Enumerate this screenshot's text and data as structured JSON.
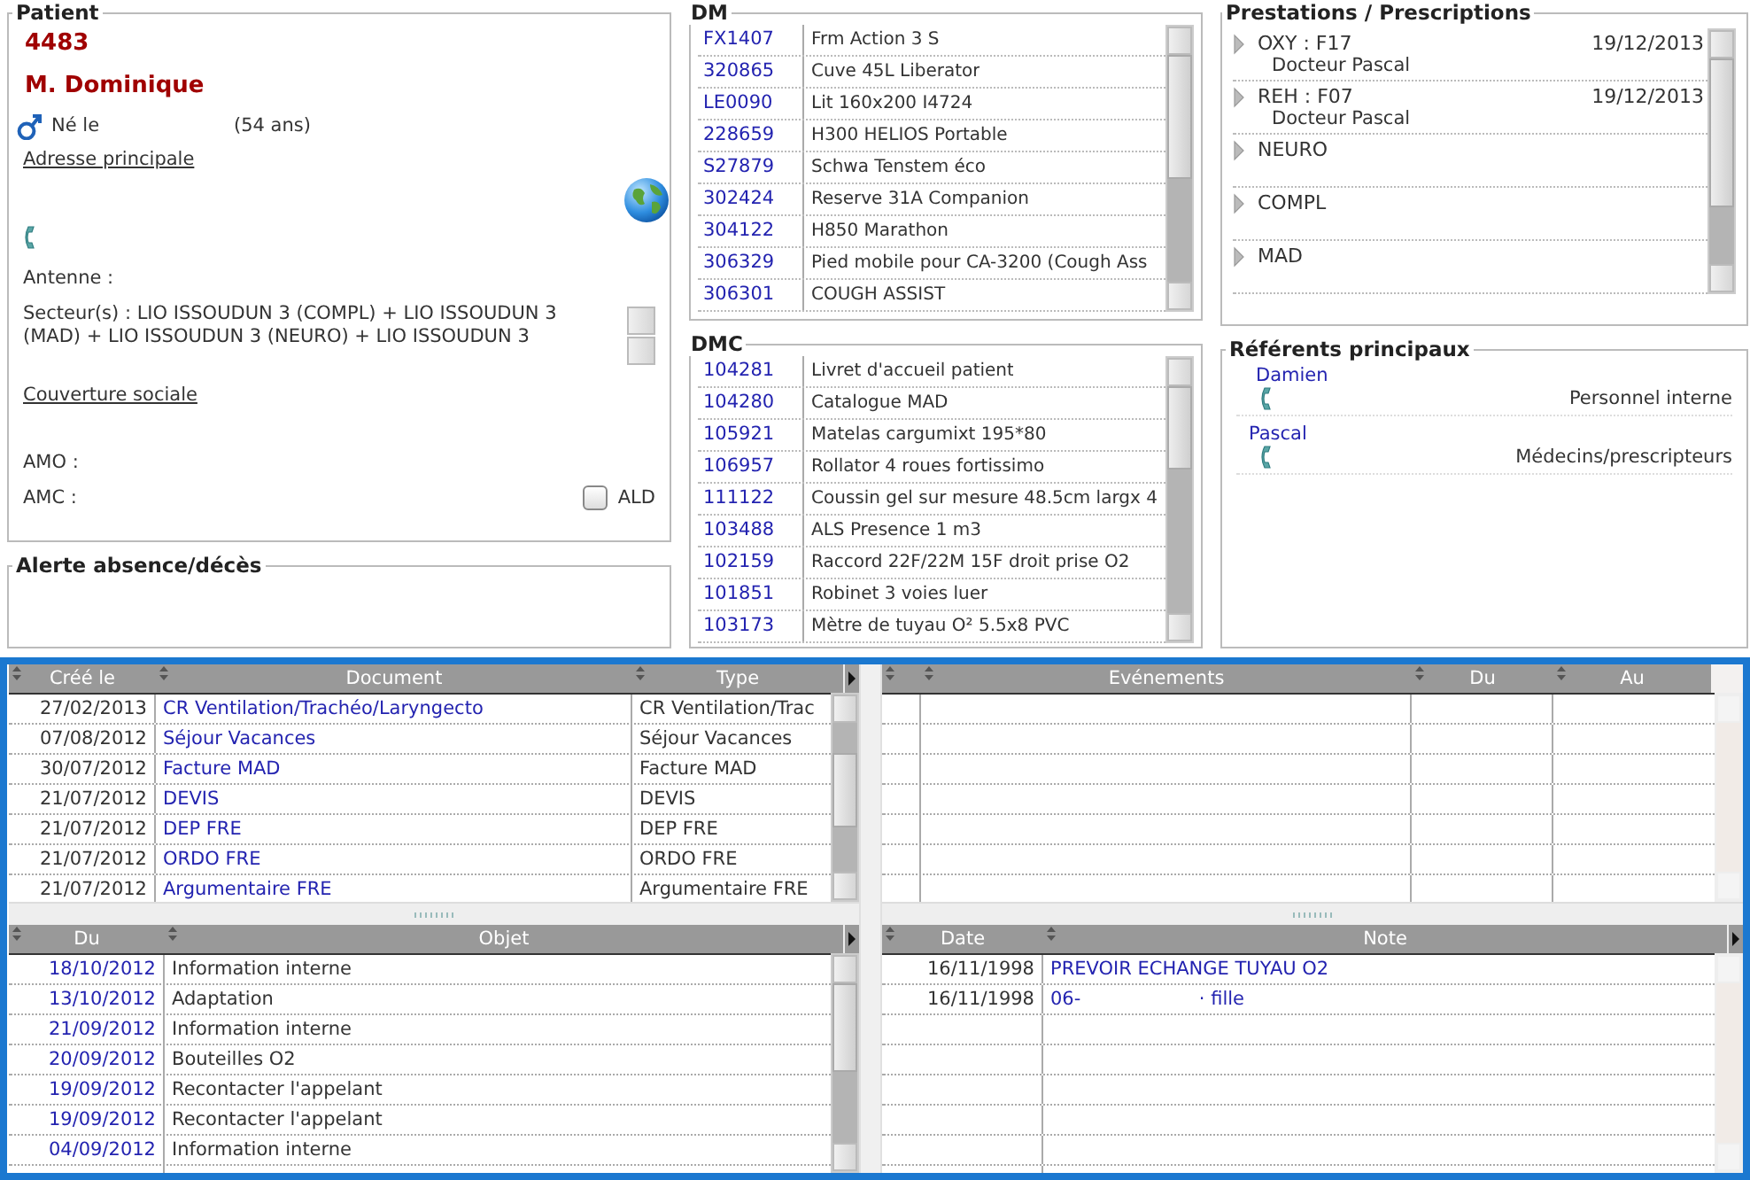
{
  "patient": {
    "legend": "Patient",
    "id": "4483",
    "name": "M. Dominique",
    "born_label": "Né le",
    "age": "(54 ans)",
    "address_link": "Adresse principale",
    "antenne_label": "Antenne :",
    "sectors": "Secteur(s) : LIO ISSOUDUN 3 (COMPL) + LIO ISSOUDUN 3 (MAD) + LIO ISSOUDUN 3 (NEURO) + LIO ISSOUDUN 3",
    "coverage_link": "Couverture sociale",
    "amo_label": "AMO :",
    "amc_label": "AMC :",
    "ald": {
      "label": "ALD",
      "checked": false
    }
  },
  "alert": {
    "legend": "Alerte absence/décès"
  },
  "dm": {
    "legend": "DM",
    "rows": [
      {
        "code": "FX1407",
        "label": "Frm Action 3 S"
      },
      {
        "code": "320865",
        "label": "Cuve 45L Liberator"
      },
      {
        "code": "LE0090",
        "label": "Lit 160x200 I4724"
      },
      {
        "code": "228659",
        "label": "H300 HELIOS Portable"
      },
      {
        "code": "S27879",
        "label": "Schwa Tenstem éco"
      },
      {
        "code": "302424",
        "label": "Reserve 31A Companion"
      },
      {
        "code": "304122",
        "label": "H850 Marathon"
      },
      {
        "code": "306329",
        "label": "Pied mobile pour CA-3200 (Cough Ass"
      },
      {
        "code": "306301",
        "label": "COUGH ASSIST"
      }
    ]
  },
  "dmc": {
    "legend": "DMC",
    "rows": [
      {
        "code": "104281",
        "label": "Livret d'accueil patient"
      },
      {
        "code": "104280",
        "label": "Catalogue MAD"
      },
      {
        "code": "105921",
        "label": "Matelas cargumixt 195*80"
      },
      {
        "code": "106957",
        "label": "Rollator 4 roues fortissimo"
      },
      {
        "code": "111122",
        "label": "Coussin gel sur mesure 48.5cm largx 4"
      },
      {
        "code": "103488",
        "label": "ALS Presence 1 m3"
      },
      {
        "code": "102159",
        "label": "Raccord 22F/22M 15F droit prise O2"
      },
      {
        "code": "101851",
        "label": "Robinet 3 voies luer"
      },
      {
        "code": "103173",
        "label": "Mètre de tuyau O² 5.5x8 PVC"
      }
    ]
  },
  "prestations": {
    "legend": "Prestations / Prescriptions",
    "items": [
      {
        "title": "OXY : F17",
        "date": "19/12/2013",
        "doctor": "Docteur Pascal"
      },
      {
        "title": "REH : F07",
        "date": "19/12/2013",
        "doctor": "Docteur Pascal"
      },
      {
        "title": "NEURO"
      },
      {
        "title": "COMPL"
      },
      {
        "title": "MAD"
      }
    ]
  },
  "referents": {
    "legend": "Référents principaux",
    "items": [
      {
        "name": "Damien",
        "role": "Personnel interne"
      },
      {
        "name": "Pascal",
        "role": "Médecins/prescripteurs"
      }
    ]
  },
  "documents": {
    "columns": [
      "Créé le",
      "Document",
      "Type"
    ],
    "rows": [
      [
        "27/02/2013",
        "CR Ventilation/Trachéo/Laryngecto",
        "CR Ventilation/Trac"
      ],
      [
        "07/08/2012",
        "Séjour Vacances",
        "Séjour Vacances"
      ],
      [
        "30/07/2012",
        "Facture MAD",
        "Facture MAD"
      ],
      [
        "21/07/2012",
        "DEVIS",
        "DEVIS"
      ],
      [
        "21/07/2012",
        "DEP FRE",
        "DEP FRE"
      ],
      [
        "21/07/2012",
        "ORDO FRE",
        "ORDO FRE"
      ],
      [
        "21/07/2012",
        "Argumentaire FRE",
        "Argumentaire FRE"
      ]
    ]
  },
  "events": {
    "columns": [
      "Evénements",
      "Du",
      "Au"
    ]
  },
  "tasks": {
    "columns": [
      "Du",
      "Objet"
    ],
    "rows": [
      [
        "18/10/2012",
        "Information interne"
      ],
      [
        "13/10/2012",
        "Adaptation"
      ],
      [
        "21/09/2012",
        "Information interne"
      ],
      [
        "20/09/2012",
        "Bouteilles O2"
      ],
      [
        "19/09/2012",
        "Recontacter l'appelant"
      ],
      [
        "19/09/2012",
        "Recontacter l'appelant"
      ],
      [
        "04/09/2012",
        "Information interne"
      ]
    ]
  },
  "notes": {
    "columns": [
      "Date",
      "Note"
    ],
    "rows": [
      [
        "16/11/1998",
        "PREVOIR ECHANGE TUYAU O2"
      ],
      [
        "16/11/1998",
        "06-                    · fille"
      ]
    ]
  }
}
